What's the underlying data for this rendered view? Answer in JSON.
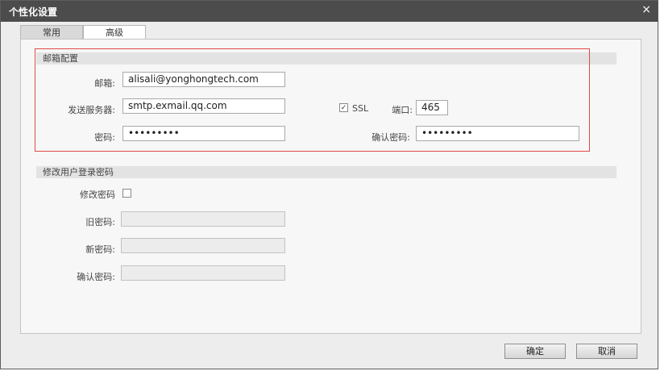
{
  "dialog": {
    "title": "个性化设置",
    "close": "×"
  },
  "tabs": [
    {
      "label": "常用"
    },
    {
      "label": "高级"
    }
  ],
  "mail": {
    "section_title": "邮箱配置",
    "email_label": "邮箱:",
    "email_value": "alisali@yonghongtech.com",
    "server_label": "发送服务器:",
    "server_value": "smtp.exmail.qq.com",
    "ssl_check": "✓",
    "ssl_label": "SSL",
    "port_label": "端口:",
    "port_value": "465",
    "password_label": "密码:",
    "password_value": "•••••••••",
    "confirm_label": "确认密码:",
    "confirm_value": "•••••••••"
  },
  "change_password": {
    "section_title": "修改用户登录密码",
    "toggle_label": "修改密码",
    "old_label": "旧密码:",
    "new_label": "新密码:",
    "confirm_label": "确认密码:"
  },
  "buttons": {
    "ok": "确定",
    "cancel": "取消"
  }
}
